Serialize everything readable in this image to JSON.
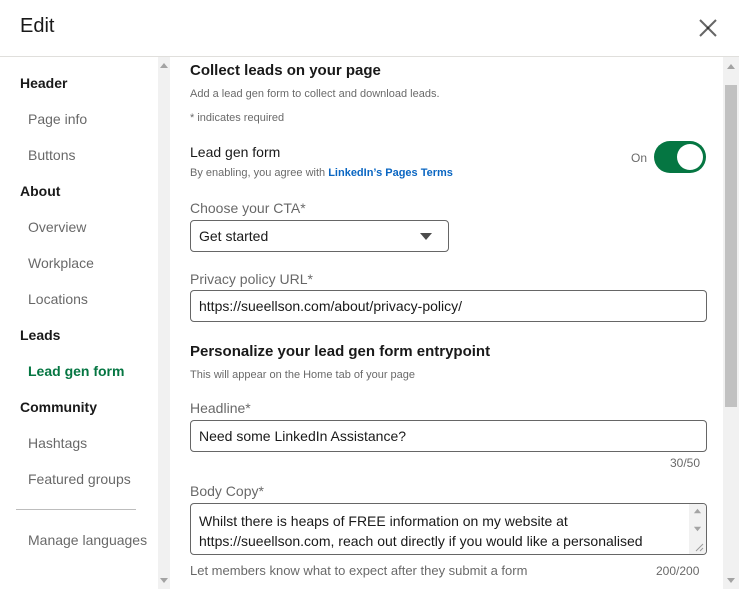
{
  "dialog": {
    "title": "Edit",
    "close_icon": "close-icon"
  },
  "sidebar": {
    "header_section": "Header",
    "page_info": "Page info",
    "buttons": "Buttons",
    "about_section": "About",
    "overview": "Overview",
    "workplace": "Workplace",
    "locations": "Locations",
    "leads_section": "Leads",
    "lead_gen_form": "Lead gen form",
    "community_section": "Community",
    "hashtags": "Hashtags",
    "featured_groups": "Featured groups",
    "manage_languages": "Manage languages"
  },
  "main": {
    "collect_title": "Collect leads on your page",
    "collect_desc": "Add a lead gen form to collect and download leads.",
    "required_note": "* indicates required",
    "lead_gen_label": "Lead gen form",
    "lead_gen_agree_prefix": "By enabling, you agree with ",
    "lead_gen_agree_link": "LinkedIn’s Pages Terms",
    "toggle_state": "On",
    "cta_label": "Choose your CTA*",
    "cta_value": "Get started",
    "privacy_label": "Privacy policy URL*",
    "privacy_value": "https://sueellson.com/about/privacy-policy/",
    "personalize_title": "Personalize your lead gen form entrypoint",
    "personalize_desc": "This will appear on the Home tab of your page",
    "headline_label": "Headline*",
    "headline_value": "Need some LinkedIn Assistance?",
    "headline_count": "30/50",
    "body_label": "Body Copy*",
    "body_value": "Whilst there is heaps of FREE information on my website at https://sueellson.com, reach out directly if you would like a personalised",
    "body_hint": "Let members know what to expect after they submit a form",
    "body_count": "200/200"
  },
  "colors": {
    "accent_green": "#057642",
    "link_blue": "#0a66c2"
  }
}
